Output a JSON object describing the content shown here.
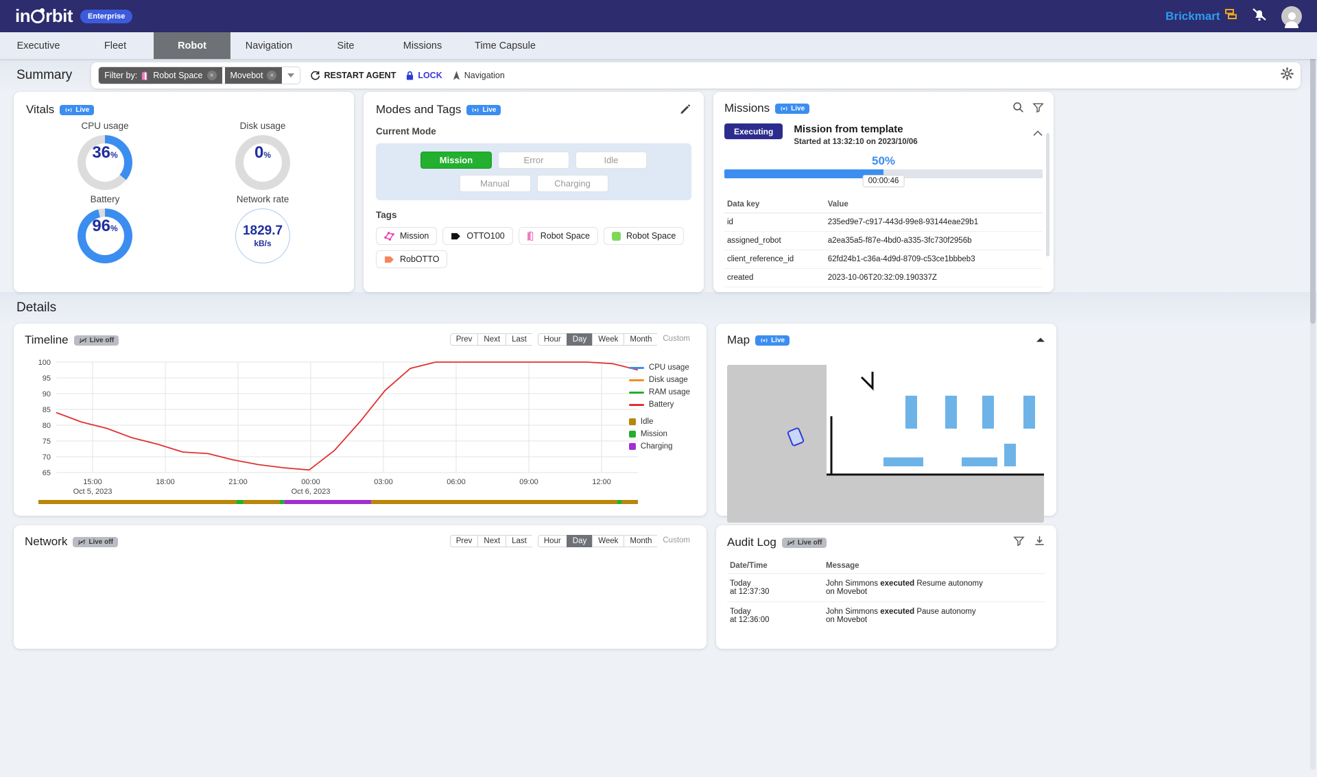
{
  "app": {
    "logo_text_left": "in",
    "logo_text_right": "rbit",
    "edition_badge": "Enterprise",
    "brand": "Brickmart",
    "mute_icon": "mute-bell-icon",
    "avatar_icon": "user-avatar-icon"
  },
  "tabs": [
    {
      "label": "Executive",
      "active": false
    },
    {
      "label": "Fleet",
      "active": false
    },
    {
      "label": "Robot",
      "active": true
    },
    {
      "label": "Navigation",
      "active": false
    },
    {
      "label": "Site",
      "active": false
    },
    {
      "label": "Missions",
      "active": false
    },
    {
      "label": "Time Capsule",
      "active": false
    }
  ],
  "summary": {
    "title": "Summary",
    "filter_label": "Filter by:",
    "chips": [
      {
        "label": "Robot Space",
        "icon": "map-icon",
        "removable": "×"
      },
      {
        "label": "Movebot",
        "icon": "none",
        "removable": "×"
      }
    ],
    "restart_label": "RESTART AGENT",
    "lock_label": "LOCK",
    "navigation_label": "Navigation",
    "gear_icon": "gear-icon"
  },
  "vitals": {
    "title": "Vitals",
    "live_label": "Live",
    "gauges": [
      {
        "label": "CPU usage",
        "value": "36",
        "unit": "%",
        "percent": 36,
        "style": "ring"
      },
      {
        "label": "Disk usage",
        "value": "0",
        "unit": "%",
        "percent": 0,
        "style": "ring"
      },
      {
        "label": "Battery",
        "value": "96",
        "unit": "%",
        "percent": 96,
        "style": "ring"
      },
      {
        "label": "Network rate",
        "value": "1829.7",
        "unit": "kB/s",
        "percent": 0,
        "style": "plain"
      }
    ]
  },
  "modes": {
    "title": "Modes and Tags",
    "live_label": "Live",
    "current_mode_label": "Current Mode",
    "edit_icon": "pencil-icon",
    "mode_buttons": [
      {
        "label": "Mission",
        "active": true
      },
      {
        "label": "Error",
        "active": false
      },
      {
        "label": "Idle",
        "active": false
      },
      {
        "label": "Manual",
        "active": false
      },
      {
        "label": "Charging",
        "active": false
      }
    ],
    "tags_label": "Tags",
    "tags": [
      {
        "label": "Mission",
        "icon": "mission-network-icon",
        "color": "#ef38b5"
      },
      {
        "label": "OTTO100",
        "icon": "tag-icon",
        "color": "#111111"
      },
      {
        "label": "Robot Space",
        "icon": "map-icon",
        "color": "#ef7ec0"
      },
      {
        "label": "Robot Space",
        "icon": "square-icon",
        "color": "#7ed957"
      },
      {
        "label": "RobOTTO",
        "icon": "tag-icon",
        "color": "#f5855c"
      }
    ]
  },
  "missions": {
    "title": "Missions",
    "live_label": "Live",
    "search_icon": "search-icon",
    "filter_icon": "filter-icon",
    "collapse_icon": "chevron-up-icon",
    "status_badge": "Executing",
    "name": "Mission from template",
    "started": "Started at 13:32:10 on 2023/10/06",
    "progress_pct": "50%",
    "progress_value": 50,
    "elapsed": "00:00:46",
    "columns": [
      "Data key",
      "Value"
    ],
    "rows": [
      {
        "key": "id",
        "value": "235ed9e7-c917-443d-99e8-93144eae29b1"
      },
      {
        "key": "assigned_robot",
        "value": "a2ea35a5-f87e-4bd0-a335-3fc730f2956b"
      },
      {
        "key": "client_reference_id",
        "value": "62fd24b1-c36a-4d9d-8709-c53ce1bbbeb3"
      },
      {
        "key": "created",
        "value": "2023-10-06T20:32:09.190337Z"
      }
    ]
  },
  "details": {
    "title": "Details"
  },
  "timeline": {
    "title": "Timeline",
    "live_label": "Live off",
    "nav_buttons": [
      "Prev",
      "Next",
      "Last"
    ],
    "ranges": [
      {
        "label": "Hour",
        "selected": false
      },
      {
        "label": "Day",
        "selected": true
      },
      {
        "label": "Week",
        "selected": false
      },
      {
        "label": "Month",
        "selected": false
      }
    ],
    "custom_label": "Custom"
  },
  "map": {
    "title": "Map",
    "live_label": "Live",
    "collapse_icon": "chevron-up-icon"
  },
  "network": {
    "title": "Network",
    "live_label": "Live off",
    "nav_buttons": [
      "Prev",
      "Next",
      "Last"
    ],
    "ranges": [
      {
        "label": "Hour",
        "selected": false
      },
      {
        "label": "Day",
        "selected": true
      },
      {
        "label": "Week",
        "selected": false
      },
      {
        "label": "Month",
        "selected": false
      }
    ],
    "custom_label": "Custom"
  },
  "audit": {
    "title": "Audit Log",
    "live_label": "Live off",
    "filter_icon": "filter-icon",
    "download_icon": "download-icon",
    "columns": [
      "Date/Time",
      "Message"
    ],
    "rows": [
      {
        "date": "Today",
        "time": "at 12:37:30",
        "actor": "John Simmons",
        "verb": "executed",
        "action": "Resume autonomy",
        "target": "on Movebot"
      },
      {
        "date": "Today",
        "time": "at 12:36:00",
        "actor": "John Simmons",
        "verb": "executed",
        "action": "Pause autonomy",
        "target": "on Movebot"
      }
    ]
  },
  "chart_data": {
    "type": "line",
    "title": "Timeline",
    "xlabel": "",
    "ylabel": "",
    "ylim": [
      65,
      100
    ],
    "yticks": [
      65,
      70,
      75,
      80,
      85,
      90,
      95,
      100
    ],
    "xticks": [
      "15:00",
      "18:00",
      "21:00",
      "00:00",
      "03:00",
      "06:00",
      "09:00",
      "12:00"
    ],
    "x_axis_captions": [
      "Oct 5, 2023",
      "Oct 6, 2023"
    ],
    "grid": true,
    "legend_position": "right",
    "series": [
      {
        "name": "CPU usage",
        "color": "#3b8ef0",
        "values": []
      },
      {
        "name": "Disk usage",
        "color": "#f28c28",
        "values": []
      },
      {
        "name": "RAM usage",
        "color": "#22b02e",
        "values": []
      },
      {
        "name": "Battery",
        "color": "#e03030",
        "x": [
          "14:00",
          "14:30",
          "15:00",
          "15:30",
          "16:00",
          "16:15",
          "16:30",
          "16:45",
          "17:00",
          "17:15",
          "17:30",
          "18:00",
          "18:30",
          "19:00",
          "19:30",
          "20:00",
          "21:00",
          "00:00",
          "03:00",
          "06:00",
          "09:00",
          "12:00",
          "12:45",
          "13:15"
        ],
        "values": [
          84,
          81,
          79,
          76,
          74,
          71.5,
          71,
          69,
          67.5,
          66.5,
          65.8,
          72,
          81,
          91,
          98,
          100,
          100,
          100,
          100,
          100,
          100,
          100,
          99.5,
          97.5
        ]
      }
    ],
    "state_legend": [
      {
        "name": "Idle",
        "color": "#b8860b"
      },
      {
        "name": "Mission",
        "color": "#22b02e"
      },
      {
        "name": "Charging",
        "color": "#a22fd0"
      }
    ],
    "state_bar": [
      {
        "state": "Idle",
        "start": 0,
        "width": 33
      },
      {
        "state": "Mission",
        "start": 33,
        "width": 1.2
      },
      {
        "state": "Idle",
        "start": 34.2,
        "width": 6
      },
      {
        "state": "Mission",
        "start": 40.2,
        "width": 0.8
      },
      {
        "state": "Charging",
        "start": 41,
        "width": 14.5
      },
      {
        "state": "Idle",
        "start": 55.5,
        "width": 41
      },
      {
        "state": "Mission",
        "start": 96.5,
        "width": 0.8
      },
      {
        "state": "Idle",
        "start": 97.3,
        "width": 2.7
      }
    ]
  }
}
